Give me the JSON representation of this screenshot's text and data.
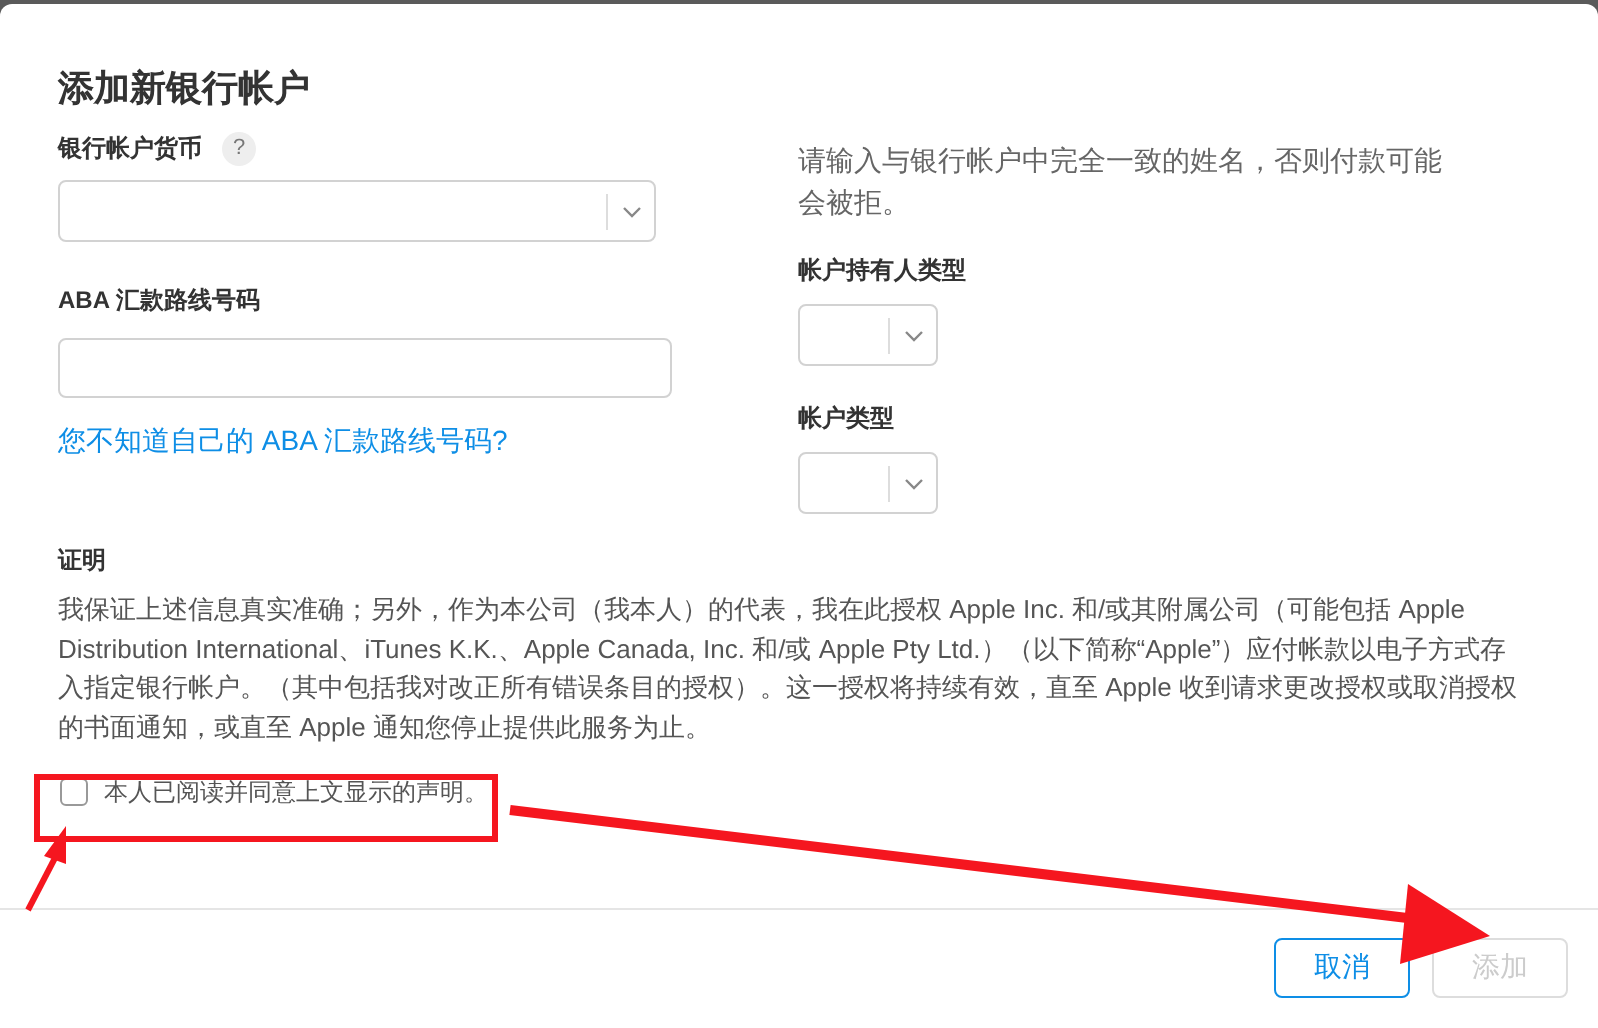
{
  "dialog": {
    "title": "添加新银行帐户"
  },
  "left": {
    "currency": {
      "label": "银行帐户货币",
      "help": "?"
    },
    "aba": {
      "label": "ABA 汇款路线号码",
      "link": "您不知道自己的 ABA 汇款路线号码?"
    }
  },
  "right": {
    "note": "请输入与银行帐户中完全一致的姓名，否则付款可能会被拒。",
    "holder_type": {
      "label": "帐户持有人类型"
    },
    "account_type": {
      "label": "帐户类型"
    }
  },
  "certification": {
    "heading": "证明",
    "text": "我保证上述信息真实准确；另外，作为本公司（我本人）的代表，我在此授权 Apple Inc. 和/或其附属公司（可能包括 Apple Distribution International、iTunes K.K.、Apple Canada, Inc. 和/或 Apple Pty Ltd.）（以下简称“Apple”）应付帐款以电子方式存入指定银行帐户。（其中包括我对改正所有错误条目的授权）。这一授权将持续有效，直至 Apple 收到请求更改授权或取消授权的书面通知，或直至 Apple 通知您停止提供此服务为止。"
  },
  "agree": {
    "label": "本人已阅读并同意上文显示的声明。",
    "checked": false
  },
  "buttons": [
    {
      "label": "取消",
      "disabled": false
    },
    {
      "label": "添加",
      "disabled": true
    }
  ]
}
